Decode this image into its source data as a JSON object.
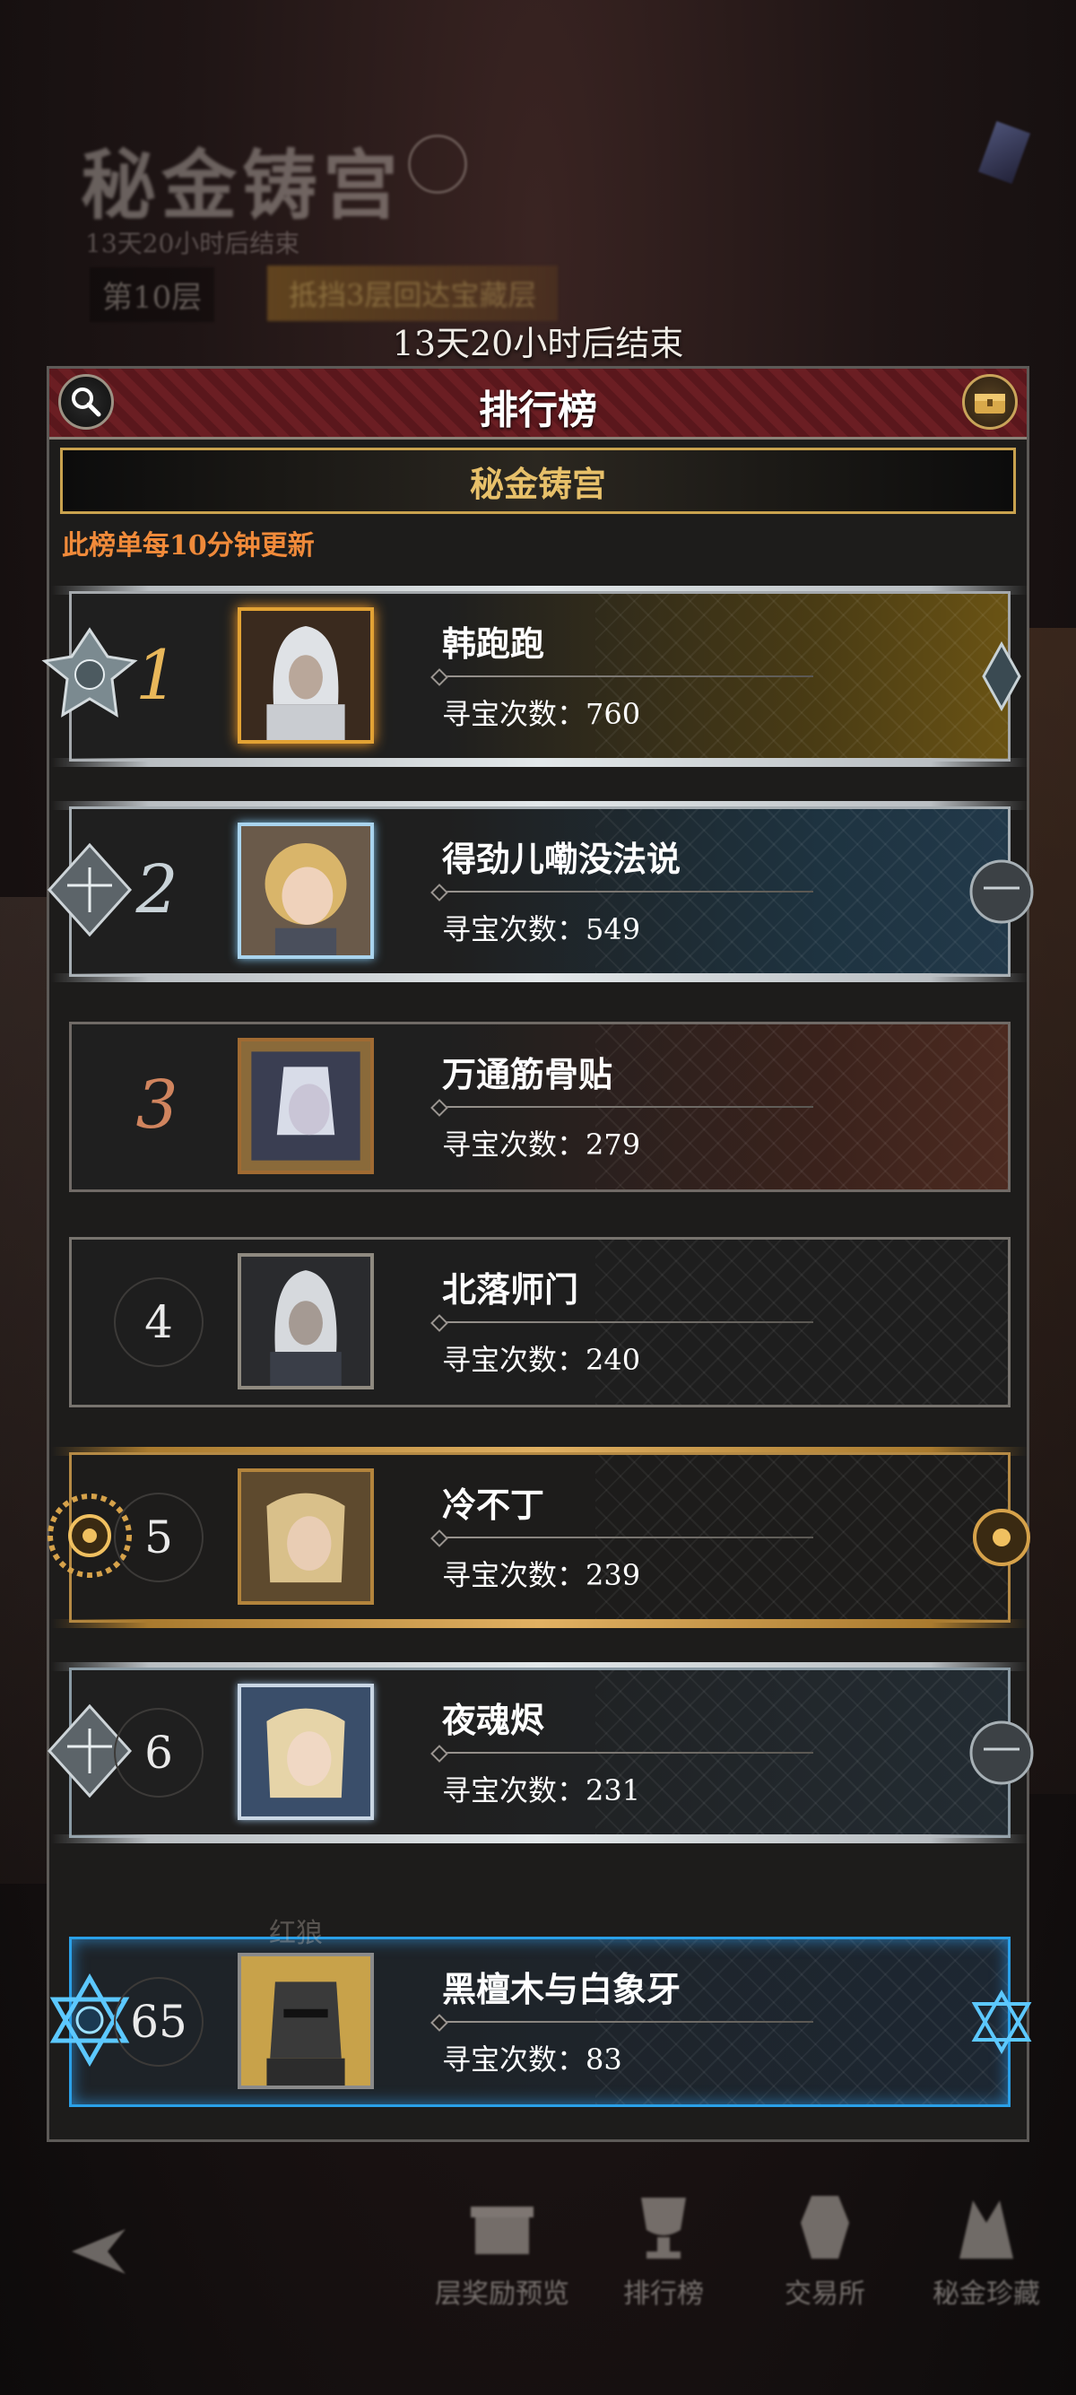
{
  "background": {
    "title": "秘金铸宫",
    "subtitle": "13天20小时后结束",
    "floor": "第10层",
    "tag": "抵挡3层回达宝藏层"
  },
  "end_timer": "13天20小时后结束",
  "panel": {
    "title": "排行榜",
    "banner": "秘金铸宫",
    "update_note": "此榜单每10分钟更新"
  },
  "stat_label": "寻宝次数：",
  "rows": [
    {
      "rank": "1",
      "name": "韩跑跑",
      "stat": "寻宝次数：760"
    },
    {
      "rank": "2",
      "name": "得劲儿嘞没法说",
      "stat": "寻宝次数：549"
    },
    {
      "rank": "3",
      "name": "万通筋骨贴",
      "stat": "寻宝次数：279"
    },
    {
      "rank": "4",
      "name": "北落师门",
      "stat": "寻宝次数：240"
    },
    {
      "rank": "5",
      "name": "冷不丁",
      "stat": "寻宝次数：239"
    },
    {
      "rank": "6",
      "name": "夜魂烬",
      "stat": "寻宝次数：231"
    }
  ],
  "partial_row_name": "红狼",
  "my_row": {
    "rank": "65",
    "name": "黑檀木与白象牙",
    "stat": "寻宝次数：83"
  },
  "nav": [
    {
      "label": "层奖励预览",
      "icon": "gift-icon"
    },
    {
      "label": "排行榜",
      "icon": "trophy-icon"
    },
    {
      "label": "交易所",
      "icon": "exchange-icon"
    },
    {
      "label": "秘金珍藏",
      "icon": "treasure-icon"
    }
  ],
  "colors": {
    "header_red": "#6b1e23",
    "gold": "#e7c06a",
    "note_orange": "#f08a3a",
    "self_highlight": "#2aa0e8"
  }
}
